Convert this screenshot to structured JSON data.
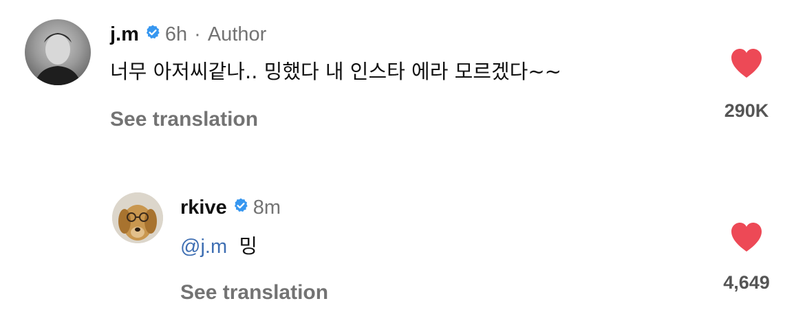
{
  "comments": [
    {
      "username": "j.m",
      "verified": true,
      "time": "6h",
      "separator": "·",
      "badge": "Author",
      "text": "너무 아저씨같나.. 밍했다 내 인스타 에라 모르겠다~~",
      "translate_label": "See translation",
      "likes": "290K",
      "liked": true
    },
    {
      "username": "rkive",
      "verified": true,
      "time": "8m",
      "mention": "@j.m",
      "text": "밍",
      "translate_label": "See translation",
      "likes": "4,649",
      "liked": true
    }
  ],
  "colors": {
    "heart": "#ed4956",
    "verified": "#3797f0",
    "mention": "#3f6fb3",
    "muted": "#737373"
  },
  "icons": {
    "verified": "verified-badge-icon",
    "like": "heart-filled-icon"
  }
}
